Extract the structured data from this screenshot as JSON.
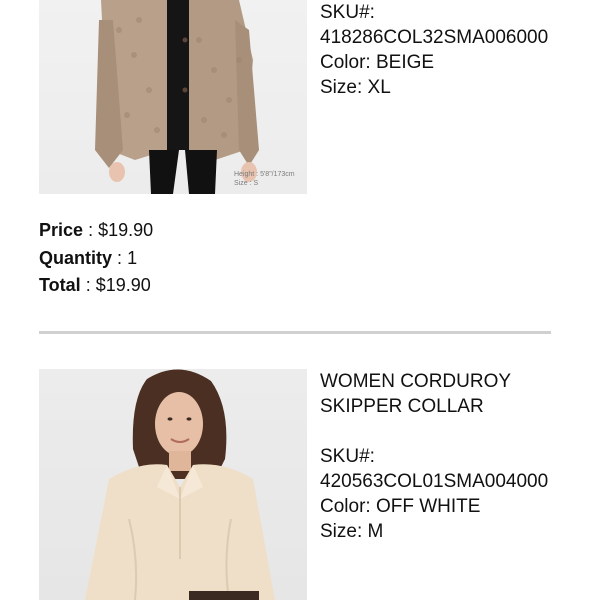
{
  "items": [
    {
      "name": "",
      "sku_label": "SKU#:",
      "sku": "418286COL32SMA006000",
      "color_label": "Color:",
      "color": "BEIGE",
      "size_label": "Size:",
      "size": "XL",
      "image_caption_height": "Height : 5'8\"/173cm",
      "image_caption_size": "Size : S",
      "price_label": "Price",
      "price": "$19.90",
      "quantity_label": "Quantity",
      "quantity": "1",
      "total_label": "Total",
      "total": "$19.90"
    },
    {
      "name_line1": "WOMEN CORDUROY",
      "name_line2": "SKIPPER COLLAR",
      "sku_label": "SKU#:",
      "sku": "420563COL01SMA004000",
      "color_label": "Color:",
      "color": "OFF WHITE",
      "size_label": "Size:",
      "size": "M"
    }
  ],
  "separator": ":"
}
